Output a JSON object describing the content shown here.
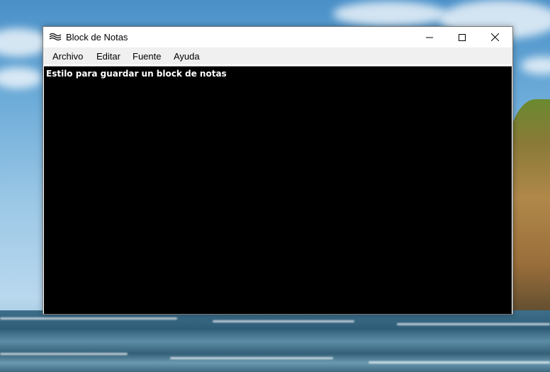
{
  "window": {
    "title": "Block de Notas",
    "app_icon": "notepad-waves-icon",
    "controls": [
      "minimize-icon",
      "maximize-icon",
      "close-icon"
    ]
  },
  "menu": {
    "items": [
      {
        "label": "Archivo"
      },
      {
        "label": "Editar"
      },
      {
        "label": "Fuente"
      },
      {
        "label": "Ayuda"
      }
    ]
  },
  "editor": {
    "text": "Estilo para guardar un block de notas",
    "background": "#000000",
    "text_color": "#ffffff"
  }
}
